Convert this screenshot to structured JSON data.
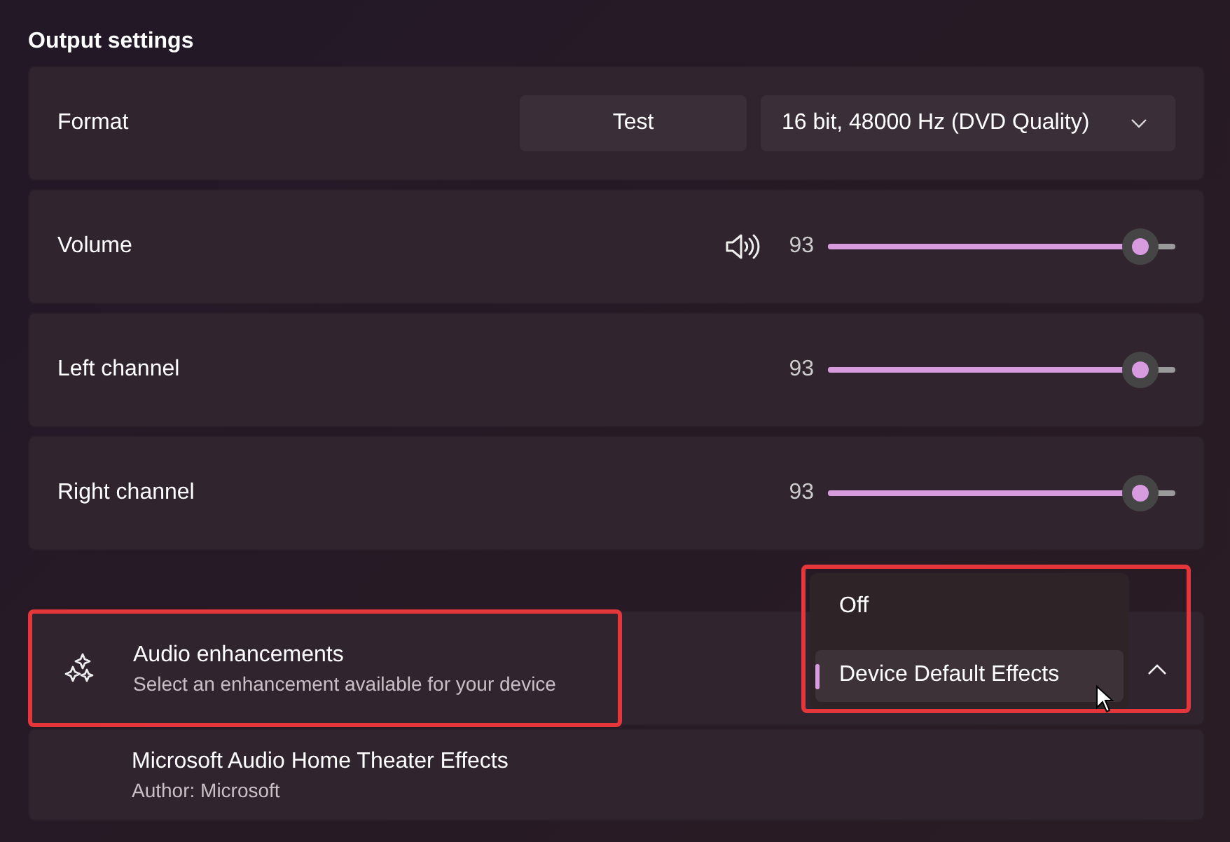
{
  "section_title": "Output settings",
  "rows": [
    {
      "kind": "format",
      "label": "Format",
      "button": "Test",
      "dropdown": "16 bit, 48000 Hz (DVD Quality)"
    },
    {
      "kind": "slider",
      "label": "Volume",
      "muted": false,
      "reading": "93",
      "level": 0.9
    },
    {
      "kind": "slider",
      "label": "Left channel",
      "reading": "93",
      "level": 0.9
    },
    {
      "kind": "slider",
      "label": "Right channel",
      "reading": "93",
      "level": 0.9
    }
  ],
  "enhancements": {
    "title": "Audio enhancements",
    "subtitle": "Select an enhancement available for your device",
    "expanded": true,
    "highlighted": true,
    "menu": {
      "highlighted": true,
      "options": [
        {
          "label": "Off",
          "selected": false
        },
        {
          "label": "Device Default Effects",
          "selected": true
        }
      ]
    },
    "items": [
      {
        "title": "Microsoft Audio Home Theater Effects",
        "subtitle": "Author: Microsoft"
      }
    ]
  }
}
